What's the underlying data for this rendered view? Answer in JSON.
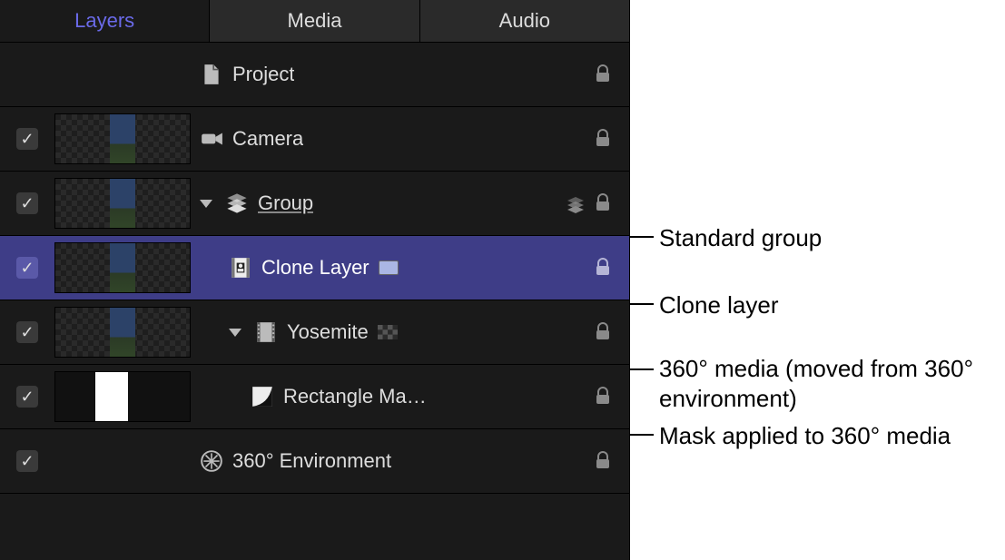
{
  "tabs": {
    "layers": "Layers",
    "media": "Media",
    "audio": "Audio"
  },
  "rows": {
    "project": {
      "label": "Project"
    },
    "camera": {
      "label": "Camera"
    },
    "group": {
      "label": "Group"
    },
    "clone": {
      "label": "Clone Layer"
    },
    "yosemite": {
      "label": "Yosemite"
    },
    "mask": {
      "label": "Rectangle Ma…"
    },
    "env360": {
      "label": "360° Environment"
    }
  },
  "callouts": {
    "group": "Standard group",
    "clone": "Clone layer",
    "media360": "360° media (moved from 360° environment)",
    "mask": "Mask applied to 360° media"
  }
}
